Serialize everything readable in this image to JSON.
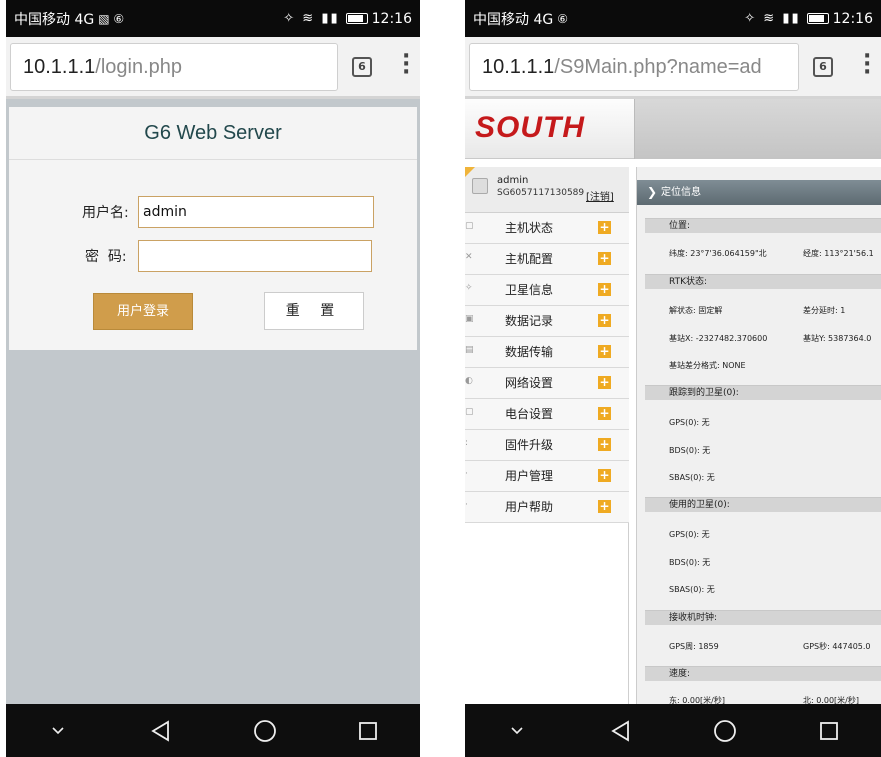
{
  "status_bar": {
    "carrier_left": "中国移动 4G",
    "carrier_right": "中国移动 4G",
    "network_4g": "4G",
    "time_left": "12:16",
    "time_right": "12:16"
  },
  "browser_left": {
    "url_host": "10.1.1.1",
    "url_path": "/login.php",
    "tab_count": "6"
  },
  "browser_right": {
    "url_host": "10.1.1.1",
    "url_path": "/S9Main.php?name=ad",
    "tab_count": "6"
  },
  "login": {
    "title": "G6 Web Server",
    "username_label": "用户名:",
    "username_value": "admin",
    "password_label": "密  码:",
    "password_value": "",
    "login_button": "用户登录",
    "reset_button": "重 置"
  },
  "main": {
    "logo": "SOUTH",
    "user": {
      "name": "admin",
      "id": "SG6057117130589",
      "logout": "[注销]"
    },
    "menu": [
      {
        "label": "主机状态"
      },
      {
        "label": "主机配置"
      },
      {
        "label": "卫星信息"
      },
      {
        "label": "数据记录"
      },
      {
        "label": "数据传输"
      },
      {
        "label": "网络设置"
      },
      {
        "label": "电台设置"
      },
      {
        "label": "固件升级"
      },
      {
        "label": "用户管理"
      },
      {
        "label": "用户帮助"
      }
    ],
    "panel_title": "定位信息",
    "sections": {
      "position": "位置:",
      "rtk": "RTK状态:",
      "tracked": "跟踪到的卫星(0):",
      "used": "使用的卫星(0):",
      "clock": "接收机时钟:",
      "speed": "速度:"
    },
    "values": {
      "latitude": "纬度: 23°7'36.064159\"北",
      "longitude": "经度: 113°21'56.1",
      "solution": "解状态: 固定解",
      "diff_delay": "差分延时: 1",
      "base_x": "基站X: -2327482.370600",
      "base_y": "基站Y: 5387364.0",
      "diff_format": "基站差分格式: NONE",
      "tracked_gps": "GPS(0): 无",
      "tracked_bds": "BDS(0): 无",
      "tracked_sbas": "SBAS(0): 无",
      "used_gps": "GPS(0): 无",
      "used_bds": "BDS(0): 无",
      "used_sbas": "SBAS(0): 无",
      "gps_week": "GPS周: 1859",
      "gps_sec": "GPS秒: 447405.0",
      "speed_east": "东: 0.00[米/秒]",
      "speed_north": "北: 0.00[米/秒]"
    }
  },
  "icons": {
    "nav_down": "chevron-down-icon",
    "nav_back": "back-triangle-icon",
    "nav_home": "home-circle-icon",
    "nav_recent": "recents-square-icon"
  }
}
